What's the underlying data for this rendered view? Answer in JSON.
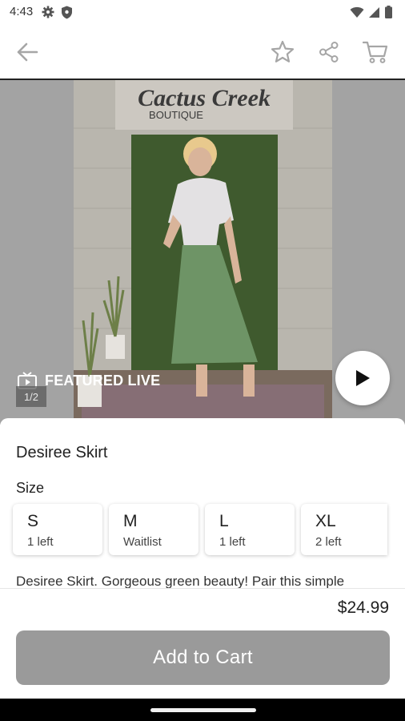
{
  "status": {
    "time": "4:43"
  },
  "icons": {
    "settings": "settings-icon",
    "shield": "shield-icon",
    "wifi": "wifi-icon",
    "signal": "signal-icon",
    "battery": "battery-icon",
    "back": "back-arrow-icon",
    "favorite": "star-icon",
    "share": "share-icon",
    "cart": "cart-icon",
    "live": "live-tv-icon",
    "play": "play-icon"
  },
  "media": {
    "featured_label": "FEATURED LIVE",
    "counter": "1/2",
    "sign_line1": "Cactus Creek",
    "sign_line2": "BOUTIQUE"
  },
  "product": {
    "name": "Desiree Skirt",
    "size_label": "Size",
    "sizes": [
      {
        "size": "S",
        "availability": "1 left"
      },
      {
        "size": "M",
        "availability": "Waitlist"
      },
      {
        "size": "L",
        "availability": "1 left"
      },
      {
        "size": "XL",
        "availability": "2 left"
      }
    ],
    "description": "Desiree Skirt. Gorgeous green beauty! Pair this simple",
    "price": "$24.99",
    "add_to_cart": "Add to Cart"
  },
  "colors": {
    "button_disabled": "#9a9a9a",
    "backdrop": "#a3a3a3"
  }
}
